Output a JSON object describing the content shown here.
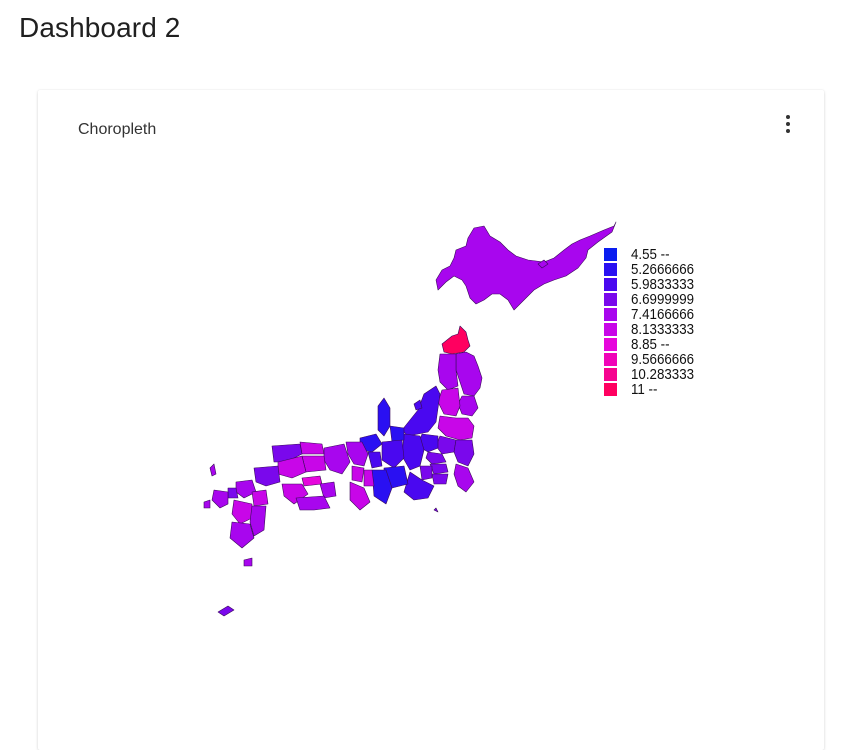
{
  "dashboard": {
    "title": "Dashboard 2"
  },
  "card": {
    "title": "Choropleth",
    "menu_icon": "more-vert-icon"
  },
  "legend": {
    "items": [
      {
        "label": "4.55 --",
        "color": "#0a1df0"
      },
      {
        "label": "5.2666666",
        "color": "#2a10f2"
      },
      {
        "label": "5.9833333",
        "color": "#4a08f0"
      },
      {
        "label": "6.6999999",
        "color": "#7a08ec"
      },
      {
        "label": "7.4166666",
        "color": "#a806ee"
      },
      {
        "label": "8.1333333",
        "color": "#c806e8"
      },
      {
        "label": "8.85 --",
        "color": "#e606dc"
      },
      {
        "label": "9.5666666",
        "color": "#f004b8"
      },
      {
        "label": "10.283333",
        "color": "#f60490"
      },
      {
        "label": "11 --",
        "color": "#ff0060"
      }
    ]
  },
  "colors": {
    "map_stroke": "#3a0a5a"
  }
}
